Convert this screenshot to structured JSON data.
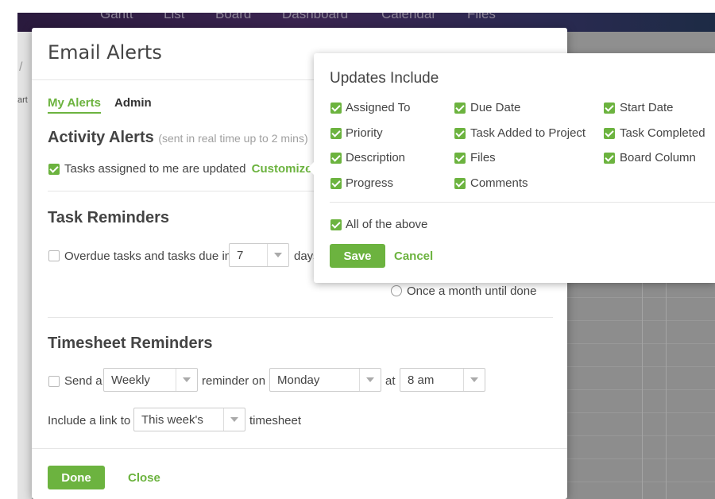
{
  "background": {
    "nav_items": [
      "Gantt",
      "List",
      "Board",
      "Dashboard",
      "Calendar",
      "Files"
    ],
    "left_label": "art"
  },
  "dialog": {
    "title": "Email Alerts",
    "tabs": [
      {
        "label": "My Alerts",
        "active": true
      },
      {
        "label": "Admin",
        "active": false
      }
    ],
    "activity": {
      "title": "Activity Alerts",
      "hint": "(sent in real time up to 2 mins)",
      "assigned_label": "Tasks assigned to me are updated",
      "assigned_checked": true,
      "customize_label": "Customize"
    },
    "task_reminders": {
      "title": "Task Reminders",
      "overdue_checked": false,
      "overdue_label": "Overdue tasks and tasks due in",
      "days_value": "7",
      "days_suffix": "days",
      "radio_label": "Once a month until done"
    },
    "timesheet": {
      "title": "Timesheet Reminders",
      "send_checked": false,
      "send_prefix": "Send a",
      "frequency_value": "Weekly",
      "reminder_on_label": "reminder on",
      "day_value": "Monday",
      "at_label": "at",
      "time_value": "8 am",
      "include_prefix": "Include a link to",
      "period_value": "This week's",
      "include_suffix": "timesheet"
    },
    "footer": {
      "done_label": "Done",
      "close_label": "Close"
    }
  },
  "popover": {
    "title": "Updates Include",
    "options": [
      {
        "label": "Assigned To",
        "checked": true
      },
      {
        "label": "Due Date",
        "checked": true
      },
      {
        "label": "Start Date",
        "checked": true
      },
      {
        "label": "Priority",
        "checked": true
      },
      {
        "label": "Task Added to Project",
        "checked": true
      },
      {
        "label": "Task Completed",
        "checked": true
      },
      {
        "label": "Description",
        "checked": true
      },
      {
        "label": "Files",
        "checked": true
      },
      {
        "label": "Board Column",
        "checked": true
      },
      {
        "label": "Progress",
        "checked": true
      },
      {
        "label": "Comments",
        "checked": true
      }
    ],
    "all_label": "All of the above",
    "all_checked": true,
    "save_label": "Save",
    "cancel_label": "Cancel"
  },
  "colors": {
    "accent": "#6cb33f",
    "text": "#444444",
    "hint": "#a0a0a0"
  }
}
